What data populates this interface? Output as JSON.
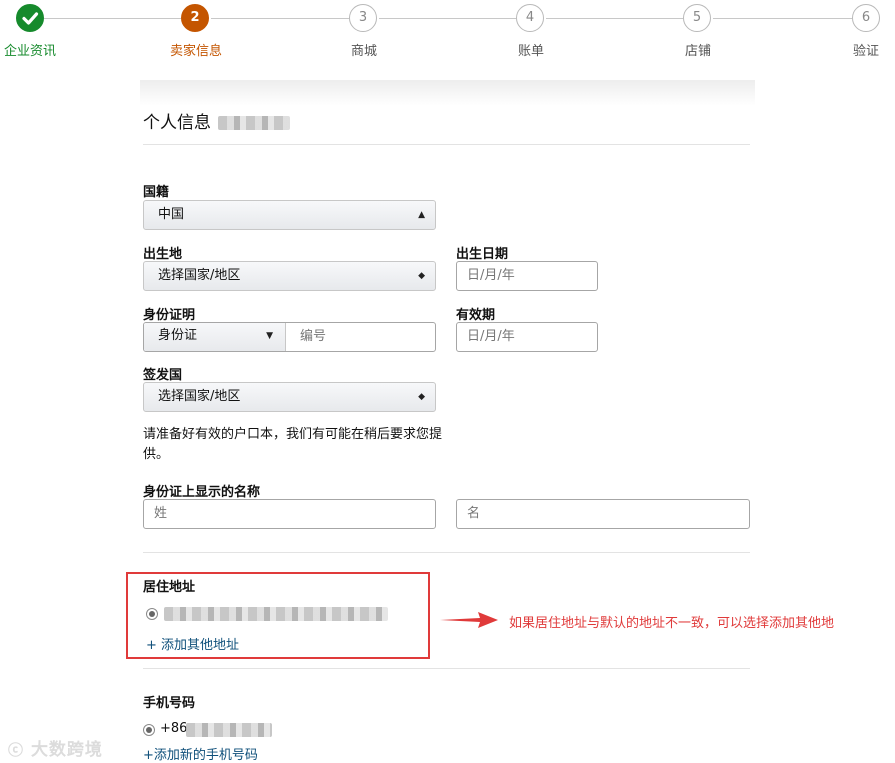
{
  "stepper": {
    "steps": [
      {
        "number": "",
        "label": "企业资讯",
        "state": "done"
      },
      {
        "number": "2",
        "label": "卖家信息",
        "state": "active"
      },
      {
        "number": "3",
        "label": "商城",
        "state": "pending"
      },
      {
        "number": "4",
        "label": "账单",
        "state": "pending"
      },
      {
        "number": "5",
        "label": "店铺",
        "state": "pending"
      },
      {
        "number": "6",
        "label": "验证",
        "state": "pending"
      }
    ]
  },
  "section": {
    "title": "个人信息"
  },
  "nationality": {
    "label": "国籍",
    "value": "中国"
  },
  "birthplace": {
    "label": "出生地",
    "value": "选择国家/地区"
  },
  "birthdate": {
    "label": "出生日期",
    "placeholder": "日/月/年"
  },
  "id_proof": {
    "label": "身份证明",
    "type_value": "身份证",
    "number_placeholder": "编号"
  },
  "expiry": {
    "label": "有效期",
    "placeholder": "日/月/年"
  },
  "issuing_country": {
    "label": "签发国",
    "value": "选择国家/地区"
  },
  "note": "请准备好有效的户口本，我们有可能在稍后要求您提供。",
  "id_name": {
    "label": "身份证上显示的名称",
    "last_placeholder": "姓",
    "first_placeholder": "名"
  },
  "address": {
    "label": "居住地址",
    "add_link": "+ 添加其他地址"
  },
  "annotation": "如果居住地址与默认的地址不一致，可以选择添加其他地",
  "phone": {
    "label": "手机号码",
    "prefix": "+86",
    "add_link": "+添加新的手机号码"
  },
  "watermark": "大数跨境",
  "colors": {
    "done": "#168a2c",
    "active": "#c45500",
    "annotation": "#e03a3a",
    "link": "#0e4f7a"
  },
  "icons": {
    "done_step": "check-icon",
    "select_arrow": "updown-arrow-icon",
    "dropdown": "caret-down-icon"
  }
}
